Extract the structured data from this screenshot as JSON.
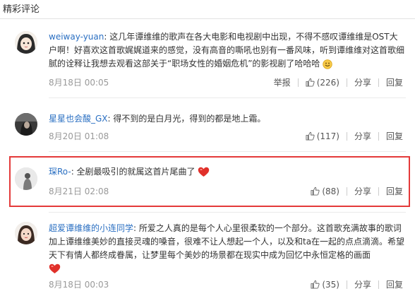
{
  "section_title": "精彩评论",
  "comments": [
    {
      "user": "weiway-yuan",
      "text": ": 这几年谭维维的歌声在各大电影和电视剧中出现，不得不感叹谭维维是OST大户啊！好喜欢这首歌娓娓道来的感觉，没有高音的嘶吼也别有一番风味，听到谭维维对这首歌细腻的诠释让我想去观看这部关于“职场女性的婚姻危机”的影视剧了哈哈哈",
      "emoji": "smile-emoji",
      "date": "8月18日 00:05",
      "report": "举报",
      "likes": "(226)",
      "share": "分享",
      "reply": "回复"
    },
    {
      "user": "星星也会酸_GX",
      "text": ": 得不到的是白月光，得到的都是地上霜。",
      "date": "8月20日 01:08",
      "likes": "(117)",
      "share": "分享",
      "reply": "回复"
    },
    {
      "user": "琛Ro-",
      "text": ": 全剧最吸引的就属这首片尾曲了",
      "emoji": "heart-emoji",
      "date": "8月21日 02:08",
      "likes": "(88)",
      "share": "分享",
      "reply": "回复"
    },
    {
      "user": "超爱谭维维的小连同学",
      "text": ": 所爱之人真的是每个人心里很柔软的一个部分。这首歌充满故事的歌词加上谭维维美妙的直接灵魂的嗓音，很难不让人想起一个人，以及和ta在一起的点点滴滴。希望天下有情人都终成眷属，让梦里每个美妙的场景都在现实中成为回忆中永恒定格的画面",
      "emoji": "heart-emoji",
      "date": "8月18日 00:03",
      "likes": "(35)",
      "share": "分享",
      "reply": "回复"
    }
  ],
  "colors": {
    "username": "#2a6fc2",
    "highlight_border": "#e43a3a",
    "meta": "#999999"
  }
}
